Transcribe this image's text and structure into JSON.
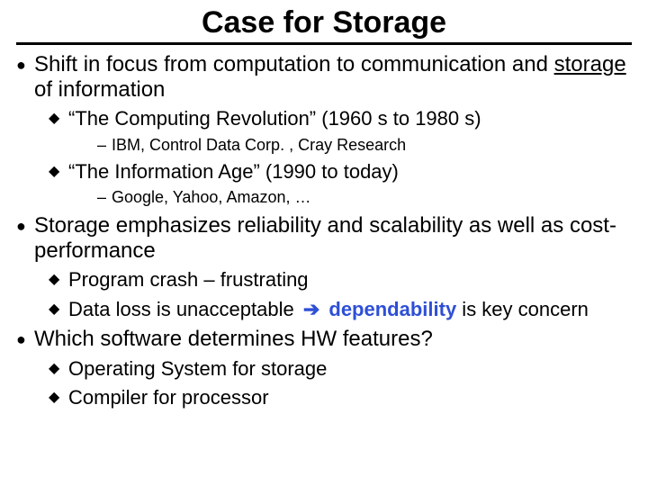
{
  "title": "Case for Storage",
  "p1": {
    "pre": "Shift in focus from computation to communication and ",
    "u": "storage",
    "post": " of information"
  },
  "p1a": "“The Computing Revolution” (1960 s to 1980 s)",
  "p1a_sub": "IBM, Control Data Corp. , Cray Research",
  "p1b": "“The Information Age” (1990 to today)",
  "p1b_sub": "Google, Yahoo, Amazon, …",
  "p2": "Storage emphasizes reliability and scalability as well as cost-performance",
  "p2a": " Program crash – frustrating",
  "p2b": {
    "pre": " Data loss is unacceptable ",
    "arrow": "➔",
    "blue": " dependability",
    "post": " is key concern"
  },
  "p3": "Which software determines HW features?",
  "p3a": "Operating System for storage",
  "p3b": "Compiler for processor",
  "dash": "–"
}
